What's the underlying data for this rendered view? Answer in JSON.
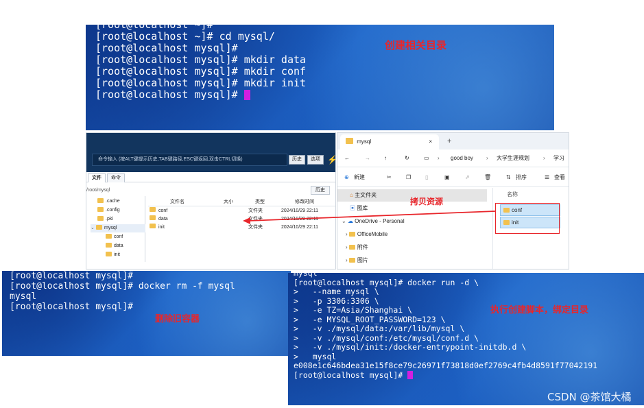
{
  "term1": {
    "lines": [
      "[root@localhost ~]#",
      "[root@localhost ~]# cd mysql/",
      "[root@localhost mysql]#",
      "[root@localhost mysql]# mkdir data",
      "[root@localhost mysql]# mkdir conf",
      "[root@localhost mysql]# mkdir init",
      "[root@localhost mysql]# "
    ],
    "annotation": "创建相关目录"
  },
  "filemanager": {
    "command_placeholder": "命令输入 (按ALT键提示历史,TAB键路径,ESC键返回,双击CTRL切换)",
    "history_button": "历史",
    "options_button": "选项",
    "tabs": [
      "文件",
      "命令"
    ],
    "path": "/root/mysql",
    "history_label": "历史",
    "tree": [
      ".cache",
      ".config",
      ".pki",
      "mysql",
      "conf",
      "data",
      "init"
    ],
    "columns": [
      "文件名",
      "大小",
      "类型",
      "修改时间"
    ],
    "rows": [
      {
        "name": "conf",
        "type": "文件夹",
        "mtime": "2024/10/29 22:11"
      },
      {
        "name": "data",
        "type": "文件夹",
        "mtime": "2024/10/29 22:11"
      },
      {
        "name": "init",
        "type": "文件夹",
        "mtime": "2024/10/29 22:11"
      }
    ]
  },
  "explorer": {
    "tab_title": "mysql",
    "tab_close": "×",
    "tab_add": "+",
    "breadcrumb": [
      "good boy",
      "大学生涯规划",
      "学习"
    ],
    "new_label": "新建",
    "sort_label": "排序",
    "view_label": "查看",
    "nav": [
      "主文件夹",
      "图库",
      "OneDrive - Personal",
      "OfficeMobile",
      "附件",
      "图片"
    ],
    "column_name": "名称",
    "files": [
      "conf",
      "init"
    ],
    "annotation": "拷贝资源"
  },
  "term2": {
    "lines": [
      "[root@localhost mysql]#",
      "[root@localhost mysql]# docker rm -f mysql",
      "mysql",
      "[root@localhost mysql]#"
    ],
    "annotation": "删除旧容器"
  },
  "term3": {
    "lines": [
      "mysql",
      "[root@localhost mysql]# docker run -d \\",
      ">   --name mysql \\",
      ">   -p 3306:3306 \\",
      ">   -e TZ=Asia/Shanghai \\",
      ">   -e MYSQL_ROOT_PASSWORD=123 \\",
      ">   -v ./mysql/data:/var/lib/mysql \\",
      ">   -v ./mysql/conf:/etc/mysql/conf.d \\",
      ">   -v ./mysql/init:/docker-entrypoint-initdb.d \\",
      ">   mysql",
      "e008e1c646bdea31e15f8ce79c26971f73818d0ef2769c4fb4d8591f77042191",
      "[root@localhost mysql]# "
    ],
    "annotation": "执行创建脚本，绑定目录"
  },
  "watermark": "CSDN @茶馆大橘",
  "colors": {
    "annotation": "#e8262b",
    "cursor": "#d21fe0",
    "terminal_bg": "#1a55b5"
  }
}
